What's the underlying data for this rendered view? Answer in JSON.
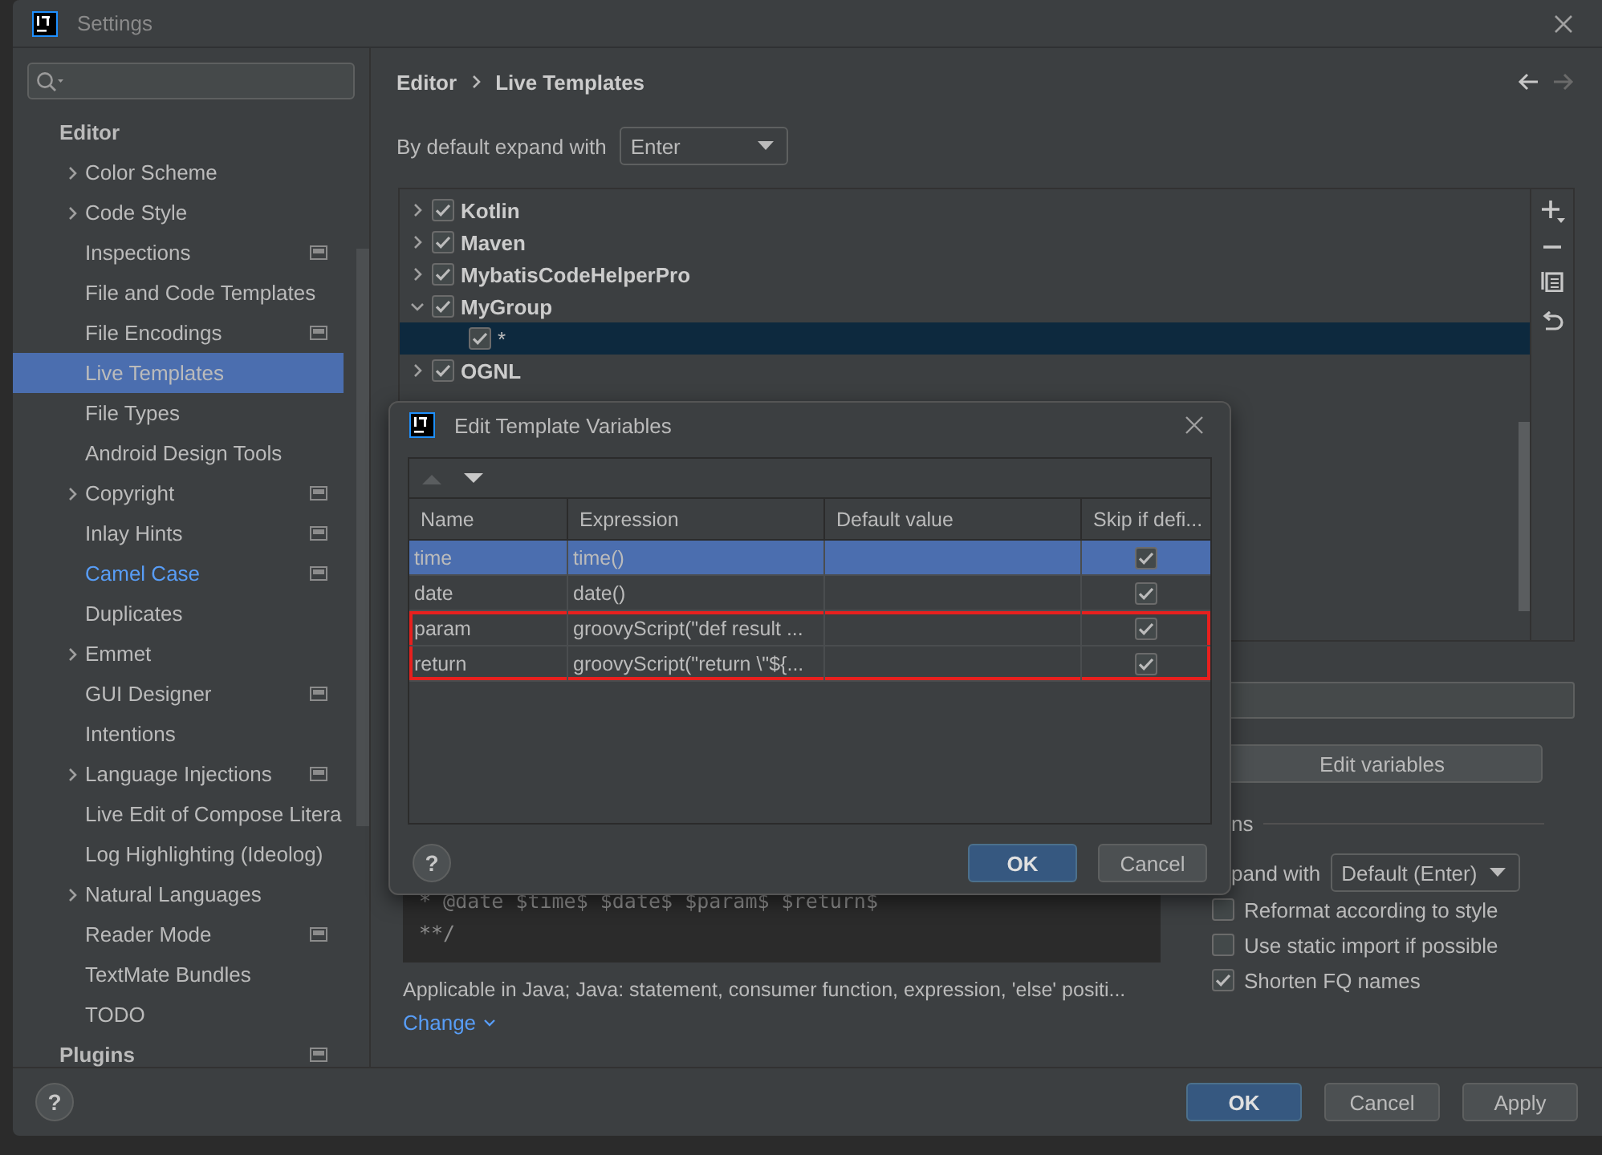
{
  "window": {
    "title": "Settings"
  },
  "sidebar": {
    "items": [
      {
        "label": "Editor",
        "kind": "header",
        "expandable": false,
        "project_scope": false,
        "modified": false,
        "selected": false
      },
      {
        "label": "Color Scheme",
        "kind": "item",
        "expandable": true,
        "project_scope": false,
        "modified": false,
        "selected": false
      },
      {
        "label": "Code Style",
        "kind": "item",
        "expandable": true,
        "project_scope": false,
        "modified": false,
        "selected": false
      },
      {
        "label": "Inspections",
        "kind": "item",
        "expandable": false,
        "project_scope": true,
        "modified": false,
        "selected": false
      },
      {
        "label": "File and Code Templates",
        "kind": "item",
        "expandable": false,
        "project_scope": false,
        "modified": false,
        "selected": false
      },
      {
        "label": "File Encodings",
        "kind": "item",
        "expandable": false,
        "project_scope": true,
        "modified": false,
        "selected": false
      },
      {
        "label": "Live Templates",
        "kind": "item",
        "expandable": false,
        "project_scope": false,
        "modified": false,
        "selected": true
      },
      {
        "label": "File Types",
        "kind": "item",
        "expandable": false,
        "project_scope": false,
        "modified": false,
        "selected": false
      },
      {
        "label": "Android Design Tools",
        "kind": "item",
        "expandable": false,
        "project_scope": false,
        "modified": false,
        "selected": false
      },
      {
        "label": "Copyright",
        "kind": "item",
        "expandable": true,
        "project_scope": true,
        "modified": false,
        "selected": false
      },
      {
        "label": "Inlay Hints",
        "kind": "item",
        "expandable": false,
        "project_scope": true,
        "modified": false,
        "selected": false
      },
      {
        "label": "Camel Case",
        "kind": "item",
        "expandable": false,
        "project_scope": true,
        "modified": true,
        "selected": false
      },
      {
        "label": "Duplicates",
        "kind": "item",
        "expandable": false,
        "project_scope": false,
        "modified": false,
        "selected": false
      },
      {
        "label": "Emmet",
        "kind": "item",
        "expandable": true,
        "project_scope": false,
        "modified": false,
        "selected": false
      },
      {
        "label": "GUI Designer",
        "kind": "item",
        "expandable": false,
        "project_scope": true,
        "modified": false,
        "selected": false
      },
      {
        "label": "Intentions",
        "kind": "item",
        "expandable": false,
        "project_scope": false,
        "modified": false,
        "selected": false
      },
      {
        "label": "Language Injections",
        "kind": "item",
        "expandable": true,
        "project_scope": true,
        "modified": false,
        "selected": false
      },
      {
        "label": "Live Edit of Compose Litera",
        "kind": "item",
        "expandable": false,
        "project_scope": false,
        "modified": false,
        "selected": false
      },
      {
        "label": "Log Highlighting (Ideolog)",
        "kind": "item",
        "expandable": false,
        "project_scope": false,
        "modified": false,
        "selected": false
      },
      {
        "label": "Natural Languages",
        "kind": "item",
        "expandable": true,
        "project_scope": false,
        "modified": false,
        "selected": false
      },
      {
        "label": "Reader Mode",
        "kind": "item",
        "expandable": false,
        "project_scope": true,
        "modified": false,
        "selected": false
      },
      {
        "label": "TextMate Bundles",
        "kind": "item",
        "expandable": false,
        "project_scope": false,
        "modified": false,
        "selected": false
      },
      {
        "label": "TODO",
        "kind": "item",
        "expandable": false,
        "project_scope": false,
        "modified": false,
        "selected": false
      },
      {
        "label": "Plugins",
        "kind": "header",
        "expandable": false,
        "project_scope": true,
        "modified": false,
        "selected": false
      }
    ]
  },
  "breadcrumb": [
    "Editor",
    "Live Templates"
  ],
  "expand": {
    "label": "By default expand with",
    "value": "Enter"
  },
  "template_groups": [
    {
      "label": "Kotlin",
      "checked": true,
      "expanded": false,
      "selected": false
    },
    {
      "label": "Maven",
      "checked": true,
      "expanded": false,
      "selected": false
    },
    {
      "label": "MybatisCodeHelperPro",
      "checked": true,
      "expanded": false,
      "selected": false
    },
    {
      "label": "MyGroup",
      "checked": true,
      "expanded": true,
      "selected": false,
      "children": [
        {
          "label": "*",
          "checked": true,
          "selected": true
        }
      ]
    },
    {
      "label": "OGNL",
      "checked": true,
      "expanded": false,
      "selected": false
    }
  ],
  "editor_panel": {
    "edit_variables_button": "Edit variables",
    "options_heading": "ns",
    "expand_label": "pand with",
    "expand_value": "Default (Enter)",
    "options": [
      {
        "label": "Reformat according to style",
        "checked": false
      },
      {
        "label": "Use static import if possible",
        "checked": false
      },
      {
        "label": "Shorten FQ names",
        "checked": true
      }
    ],
    "template_text": [
      "* @date $time$ $date$ $param$ $return$",
      "**/"
    ],
    "applicable": "Applicable in Java; Java: statement, consumer function, expression, 'else' positi...",
    "change_link": "Change"
  },
  "dialog": {
    "title": "Edit Template Variables",
    "columns": [
      "Name",
      "Expression",
      "Default value",
      "Skip if defi..."
    ],
    "rows": [
      {
        "name": "time",
        "expression": "time()",
        "skip": true,
        "selected": true,
        "highlighted": false
      },
      {
        "name": "date",
        "expression": "date()",
        "skip": true,
        "selected": false,
        "highlighted": false
      },
      {
        "name": "param",
        "expression": "groovyScript(\"def result ...",
        "skip": true,
        "selected": false,
        "highlighted": true
      },
      {
        "name": "return",
        "expression": "groovyScript(\"return \\\"${...",
        "skip": true,
        "selected": false,
        "highlighted": true
      }
    ],
    "help_button": "?",
    "buttons": [
      {
        "label": "OK",
        "kind": "primary"
      },
      {
        "label": "Cancel",
        "kind": "secondary"
      }
    ]
  },
  "help_button": "?",
  "footer_buttons": [
    {
      "label": "OK",
      "kind": "primary"
    },
    {
      "label": "Cancel",
      "kind": "secondary"
    },
    {
      "label": "Apply",
      "kind": "secondary"
    }
  ]
}
